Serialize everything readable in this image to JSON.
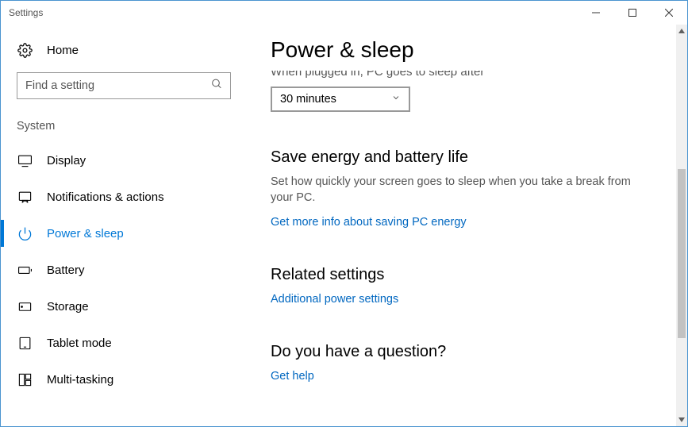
{
  "window": {
    "title": "Settings"
  },
  "sidebar": {
    "home_label": "Home",
    "search_placeholder": "Find a setting",
    "section_label": "System",
    "items": [
      {
        "label": "Display"
      },
      {
        "label": "Notifications & actions"
      },
      {
        "label": "Power & sleep"
      },
      {
        "label": "Battery"
      },
      {
        "label": "Storage"
      },
      {
        "label": "Tablet mode"
      },
      {
        "label": "Multi-tasking"
      }
    ]
  },
  "page": {
    "title": "Power & sleep",
    "sleep_label_cut": "When plugged in, PC goes to sleep after",
    "sleep_dropdown_value": "30 minutes",
    "save_energy": {
      "heading": "Save energy and battery life",
      "desc": "Set how quickly your screen goes to sleep when you take a break from your PC.",
      "link": "Get more info about saving PC energy"
    },
    "related": {
      "heading": "Related settings",
      "link": "Additional power settings"
    },
    "question": {
      "heading": "Do you have a question?",
      "link": "Get help"
    }
  }
}
